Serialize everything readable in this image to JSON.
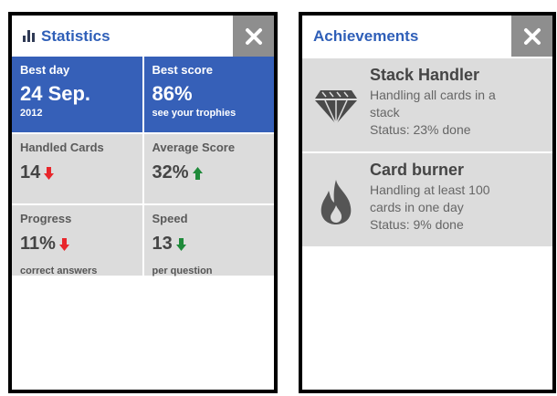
{
  "statistics": {
    "title": "Statistics",
    "cells": {
      "best_day": {
        "label": "Best day",
        "value": "24 Sep.",
        "sub": "2012"
      },
      "best_score": {
        "label": "Best score",
        "value": "86%",
        "sub": "see your trophies"
      },
      "handled_cards": {
        "label": "Handled Cards",
        "value": "14",
        "trend": "down"
      },
      "average_score": {
        "label": "Average Score",
        "value": "32%",
        "trend": "up"
      },
      "progress": {
        "label": "Progress",
        "value": "11%",
        "sub": "correct answers",
        "trend": "down"
      },
      "speed": {
        "label": "Speed",
        "value": "13",
        "sub": "per question",
        "trend": "down"
      }
    }
  },
  "achievements": {
    "title": "Achievements",
    "items": [
      {
        "name": "Stack Handler",
        "desc_line1": "Handling all cards in a",
        "desc_line2": "stack",
        "status": "Status: 23% done",
        "icon": "diamond-icon"
      },
      {
        "name": "Card burner",
        "desc_line1": "Handling at least 100",
        "desc_line2": "cards in one day",
        "status": "Status: 9% done",
        "icon": "flame-icon"
      }
    ]
  },
  "colors": {
    "accent_blue": "#3660b8",
    "title_blue": "#2f5fb8",
    "trend_down": "#e8262b",
    "trend_up": "#1f8a3a",
    "trend_speed_down": "#1f8a3a",
    "cell_gray": "#dcdcdc",
    "close_gray": "#8e8e8e"
  }
}
